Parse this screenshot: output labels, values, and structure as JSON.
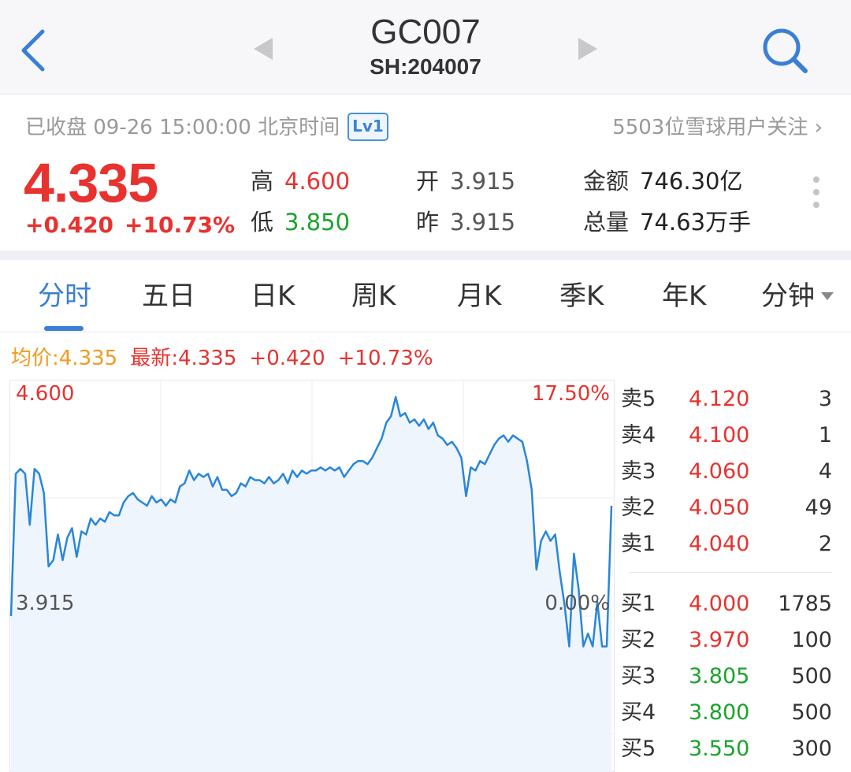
{
  "header": {
    "title": "GC007",
    "code": "SH:204007"
  },
  "status": {
    "text": "已收盘 09-26 15:00:00 北京时间",
    "level_badge": "Lv1",
    "followers": "5503位雪球用户关注 ›"
  },
  "quote": {
    "price": "4.335",
    "change": "+0.420",
    "change_pct": "+10.73%",
    "high_label": "高",
    "high": "4.600",
    "low_label": "低",
    "low": "3.850",
    "open_label": "开",
    "open": "3.915",
    "prev_label": "昨",
    "prev": "3.915",
    "amount_label": "金额",
    "amount": "746.30亿",
    "volume_label": "总量",
    "volume": "74.63万手"
  },
  "tabs": [
    "分时",
    "五日",
    "日K",
    "周K",
    "月K",
    "季K",
    "年K",
    "分钟"
  ],
  "info_line": {
    "avg": "均价:4.335",
    "latest": "最新:4.335",
    "change": "+0.420",
    "change_pct": "+10.73%"
  },
  "chart_data": {
    "type": "line",
    "y_max_label": "4.600",
    "y_base_label": "3.915",
    "pct_max_label": "17.50%",
    "pct_base_label": "0.00%",
    "y_range": [
      3.915,
      4.6
    ],
    "series": [
      {
        "values": [
          3.915,
          4.36,
          4.375,
          4.36,
          4.2,
          4.375,
          4.36,
          4.3,
          4.07,
          4.09,
          4.17,
          4.09,
          4.16,
          4.19,
          4.1,
          4.18,
          4.17,
          4.22,
          4.2,
          4.22,
          4.21,
          4.24,
          4.23,
          4.23,
          4.27,
          4.29,
          4.3,
          4.28,
          4.27,
          4.26,
          4.29,
          4.27,
          4.28,
          4.26,
          4.28,
          4.27,
          4.32,
          4.33,
          4.37,
          4.34,
          4.36,
          4.35,
          4.36,
          4.32,
          4.35,
          4.31,
          4.31,
          4.29,
          4.3,
          4.33,
          4.32,
          4.35,
          4.34,
          4.34,
          4.33,
          4.35,
          4.33,
          4.34,
          4.36,
          4.33,
          4.37,
          4.35,
          4.37,
          4.36,
          4.37,
          4.37,
          4.38,
          4.37,
          4.38,
          4.37,
          4.38,
          4.35,
          4.37,
          4.39,
          4.4,
          4.4,
          4.39,
          4.41,
          4.44,
          4.47,
          4.52,
          4.54,
          4.6,
          4.54,
          4.55,
          4.52,
          4.53,
          4.51,
          4.53,
          4.5,
          4.52,
          4.48,
          4.47,
          4.45,
          4.46,
          4.44,
          4.41,
          4.29,
          4.38,
          4.37,
          4.4,
          4.39,
          4.42,
          4.45,
          4.47,
          4.48,
          4.46,
          4.48,
          4.47,
          4.46,
          4.4,
          4.31,
          4.06,
          4.15,
          4.18,
          4.15,
          4.17,
          4.05,
          3.95,
          3.82,
          4.11,
          4.0,
          3.82,
          3.86,
          3.82,
          3.96,
          3.82,
          3.82,
          4.26
        ]
      }
    ],
    "grid": true
  },
  "order_book": {
    "asks": [
      {
        "label": "卖5",
        "price": "4.120",
        "vol": "3",
        "color": "red"
      },
      {
        "label": "卖4",
        "price": "4.100",
        "vol": "1",
        "color": "red"
      },
      {
        "label": "卖3",
        "price": "4.060",
        "vol": "4",
        "color": "red"
      },
      {
        "label": "卖2",
        "price": "4.050",
        "vol": "49",
        "color": "red"
      },
      {
        "label": "卖1",
        "price": "4.040",
        "vol": "2",
        "color": "red"
      }
    ],
    "bids": [
      {
        "label": "买1",
        "price": "4.000",
        "vol": "1785",
        "color": "red"
      },
      {
        "label": "买2",
        "price": "3.970",
        "vol": "100",
        "color": "red"
      },
      {
        "label": "买3",
        "price": "3.805",
        "vol": "500",
        "color": "green"
      },
      {
        "label": "买4",
        "price": "3.800",
        "vol": "500",
        "color": "green"
      },
      {
        "label": "买5",
        "price": "3.550",
        "vol": "300",
        "color": "green"
      }
    ]
  },
  "colors": {
    "up": "#e8322f",
    "down": "#1aa32b",
    "accent": "#3a7fd5",
    "avg": "#f39a1c"
  },
  "icons": {
    "back": "back-icon",
    "search": "search-icon",
    "prev": "prev-stock-icon",
    "next": "next-stock-icon",
    "more": "more-icon"
  }
}
